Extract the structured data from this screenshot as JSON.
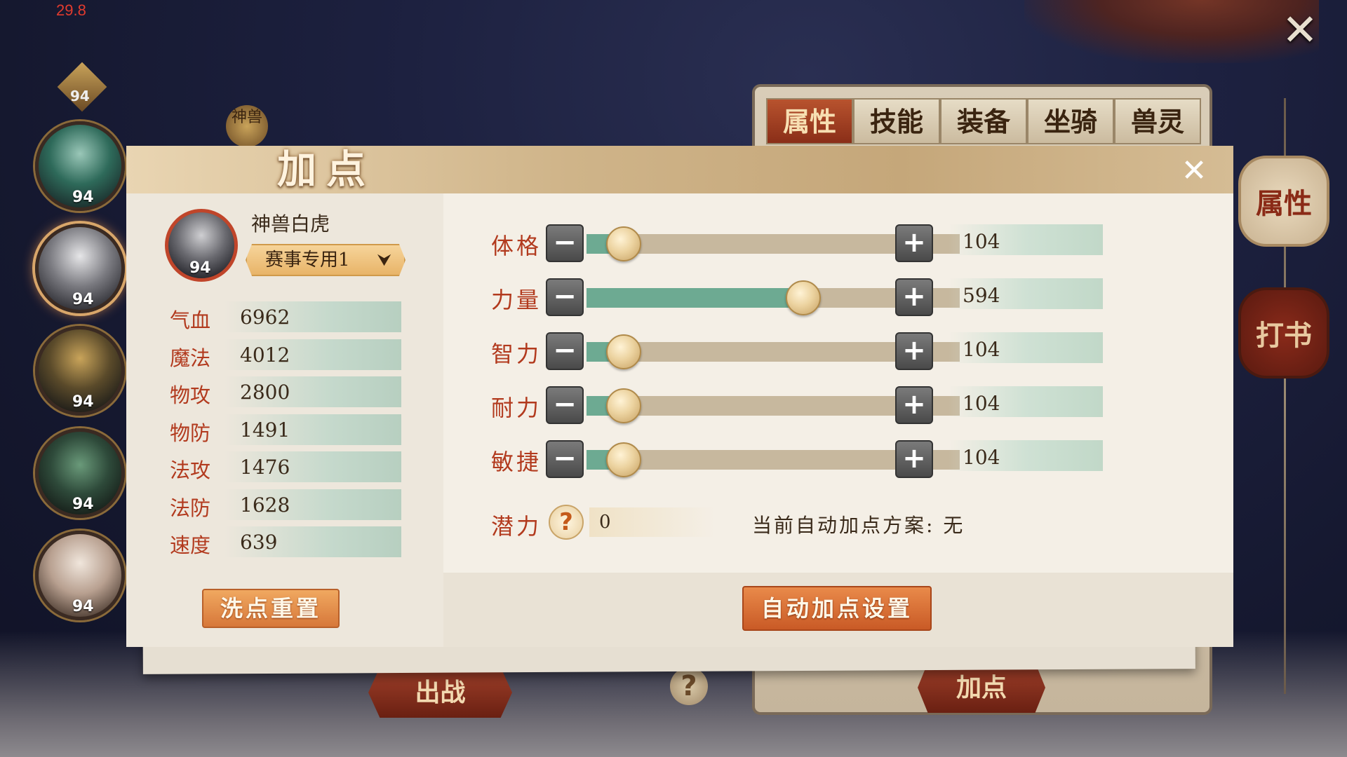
{
  "hud": {
    "fps": "29.8"
  },
  "rail": {
    "levels": [
      "94",
      "94",
      "94",
      "94",
      "94"
    ],
    "top_level": "94",
    "shengshou_tag": "神兽"
  },
  "right_tabs": [
    "属性",
    "技能",
    "装备",
    "坐骑",
    "兽灵"
  ],
  "side_buttons": {
    "attr": "属性",
    "book": "打书"
  },
  "bottom_buttons": {
    "chuzhan": "出战",
    "jiadian": "加点",
    "help": "?"
  },
  "dialog": {
    "title": "加点",
    "close": "✕",
    "pet": {
      "name": "神兽白虎",
      "level": "94",
      "scheme": "赛事专用1"
    },
    "stats": [
      {
        "label": "气血",
        "value": "6962"
      },
      {
        "label": "魔法",
        "value": "4012"
      },
      {
        "label": "物攻",
        "value": "2800"
      },
      {
        "label": "物防",
        "value": "1491"
      },
      {
        "label": "法攻",
        "value": "1476"
      },
      {
        "label": "法防",
        "value": "1628"
      },
      {
        "label": "速度",
        "value": "639"
      }
    ],
    "attributes": [
      {
        "label": "体格",
        "value": "104",
        "fill": 0.1
      },
      {
        "label": "力量",
        "value": "594",
        "fill": 0.58
      },
      {
        "label": "智力",
        "value": "104",
        "fill": 0.1
      },
      {
        "label": "耐力",
        "value": "104",
        "fill": 0.1
      },
      {
        "label": "敏捷",
        "value": "104",
        "fill": 0.1
      }
    ],
    "potential": {
      "label": "潜力",
      "help": "?",
      "value": "0",
      "auto_scheme": "当前自动加点方案: 无"
    },
    "buttons": {
      "reset": "洗点重置",
      "auto": "自动加点设置",
      "minus": "−",
      "plus": "+"
    }
  },
  "colors": {
    "accent_red": "#b23a1e",
    "slider_fill": "#6daa92",
    "button_orange": "#d7783a"
  }
}
